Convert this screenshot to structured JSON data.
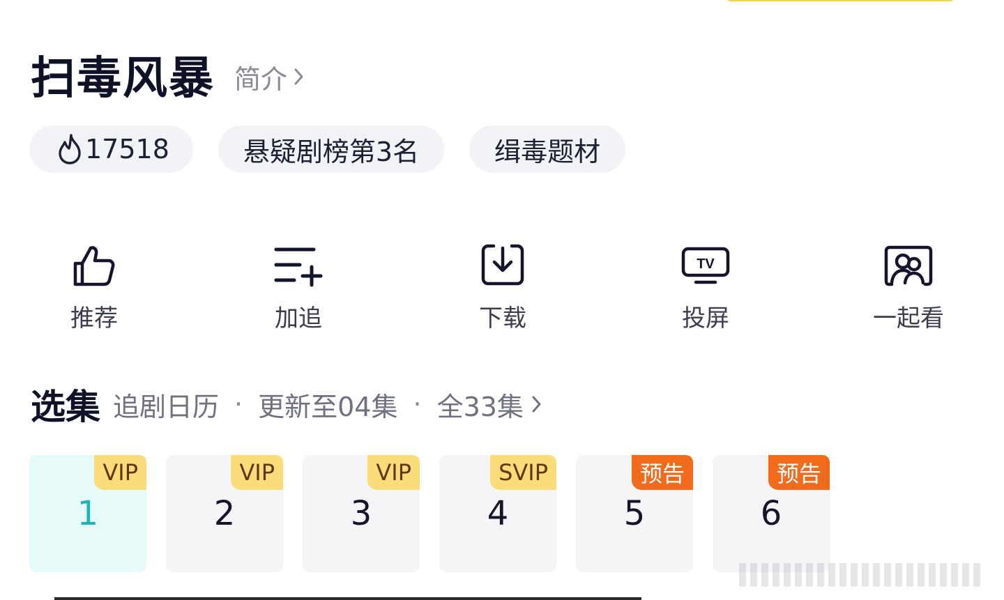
{
  "show": {
    "title": "扫毒风暴",
    "intro_label": "简介"
  },
  "tags": [
    {
      "label": "17518",
      "icon": "flame-icon"
    },
    {
      "label": "悬疑剧榜第3名"
    },
    {
      "label": "缉毒题材"
    }
  ],
  "actions": [
    {
      "label": "推荐",
      "icon": "thumbs-up-icon"
    },
    {
      "label": "加追",
      "icon": "add-to-list-icon"
    },
    {
      "label": "下载",
      "icon": "download-icon"
    },
    {
      "label": "投屏",
      "icon": "tv-cast-icon"
    },
    {
      "label": "一起看",
      "icon": "watch-together-icon"
    }
  ],
  "episodes_section": {
    "title": "选集",
    "calendar": "追剧日历",
    "updated": "更新至04集",
    "total": "全33集"
  },
  "episodes": [
    {
      "number": "1",
      "badge": "VIP",
      "badge_type": "vip",
      "selected": true
    },
    {
      "number": "2",
      "badge": "VIP",
      "badge_type": "vip"
    },
    {
      "number": "3",
      "badge": "VIP",
      "badge_type": "vip"
    },
    {
      "number": "4",
      "badge": "SVIP",
      "badge_type": "vip"
    },
    {
      "number": "5",
      "badge": "预告",
      "badge_type": "preview"
    },
    {
      "number": "6",
      "badge": "预告",
      "badge_type": "preview"
    }
  ],
  "colors": {
    "title": "#0f1226",
    "muted": "#8a8a96",
    "tag_bg": "#f2f3f7",
    "vip_badge": "#fbdc7a",
    "preview_badge": "#f26b1d",
    "selected_episode_bg": "#e6fafa",
    "selected_episode_text": "#1fb3b8"
  }
}
